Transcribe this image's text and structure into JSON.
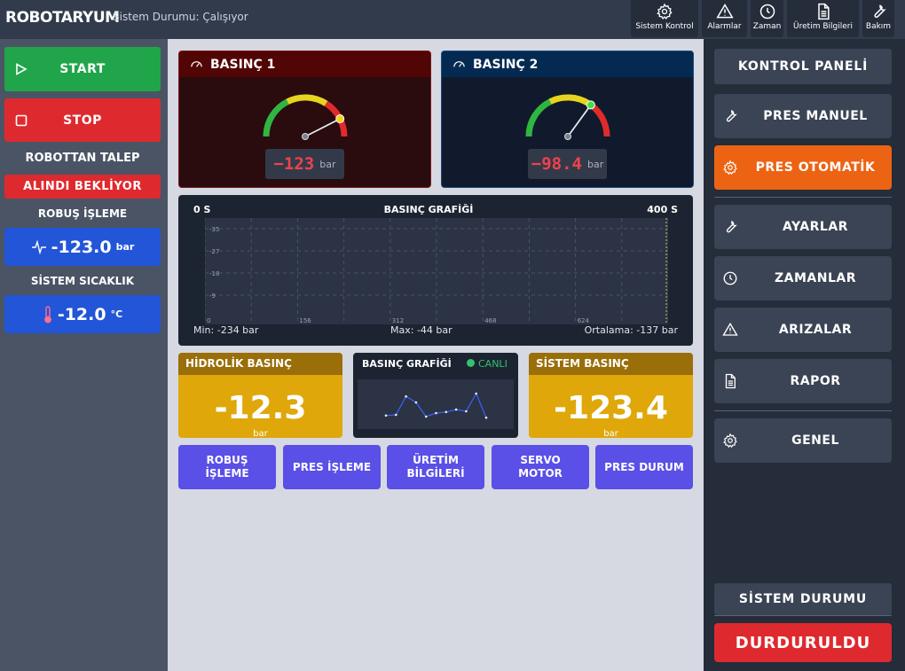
{
  "header": {
    "title": "ROBOTARYUM",
    "status": "Sistem Durumu: Çalışıyor",
    "buttons": [
      {
        "label": "Sistem Kontrol",
        "icon": "gear-icon"
      },
      {
        "label": "Alarmlar",
        "icon": "warning-icon"
      },
      {
        "label": "Zaman",
        "icon": "clock-icon"
      },
      {
        "label": "Üretim Bilgileri",
        "icon": "document-icon"
      },
      {
        "label": "Bakım",
        "icon": "wrench-icon"
      }
    ]
  },
  "left": {
    "start_label": "START",
    "stop_label": "STOP",
    "robot_request_title": "ROBOTTAN TALEP",
    "robot_request_value": "ALINDI BEKLİYOR",
    "robot_work_title": "ROBUŞ İŞLEME",
    "robot_work_value": "-123.0",
    "robot_work_unit": "bar",
    "temp_title": "SİSTEM SICAKLIK",
    "temp_value": "-12.0",
    "temp_unit": "°C"
  },
  "gauge1": {
    "title": "BASINÇ 1",
    "value": "−123",
    "unit": "bar",
    "needle_fraction": 0.85,
    "header_color": "#520505",
    "body_color": "#2a0b0e"
  },
  "gauge2": {
    "title": "BASINÇ 2",
    "value": "−98.4",
    "unit": "bar",
    "needle_fraction": 0.7,
    "header_color": "#052a52",
    "body_color": "#101a2c"
  },
  "chart": {
    "title": "BASINÇ GRAFİĞİ",
    "x_start_label": "0 S",
    "x_end_label": "400 S",
    "min_text": "Min: -234 bar",
    "max_text": "Max: -44 bar",
    "avg_text": "Ortalama: -137 bar"
  },
  "chart_data": {
    "type": "line",
    "title": "BASINÇ GRAFİĞİ",
    "y_ticks": [
      "-35",
      "-27",
      "-18",
      "-9"
    ],
    "x_ticks": [
      "0",
      "156",
      "312",
      "468",
      "624"
    ],
    "ylim": [
      -44,
      0
    ],
    "xlim": [
      0,
      780
    ],
    "series": [],
    "grid": true
  },
  "tiles": {
    "hydraulic": {
      "title": "HİDROLİK BASINÇ",
      "value": "-12.3",
      "unit": "bar"
    },
    "system": {
      "title": "SİSTEM BASINÇ",
      "value": "-123.4",
      "unit": "bar"
    }
  },
  "mini_chart": {
    "title": "BASINÇ GRAFİĞİ",
    "live_label": "CANLI",
    "live_color": "#31c46c",
    "values": [
      0.18,
      0.2,
      0.72,
      0.55,
      0.15,
      0.25,
      0.28,
      0.35,
      0.3,
      0.8,
      0.12
    ]
  },
  "process_buttons": [
    "ROBUŞ İŞLEME",
    "PRES İŞLEME",
    "ÜRETİM BİLGİLERİ",
    "SERVO MOTOR",
    "PRES DURUM"
  ],
  "right": {
    "panel_title": "KONTROL PANELİ",
    "items": [
      {
        "label": "PRES MANUEL",
        "icon": "wrench-icon"
      },
      {
        "label": "PRES OTOMATİK",
        "icon": "gear-icon",
        "active": true
      },
      {
        "label": "AYARLAR",
        "icon": "wrench-icon"
      },
      {
        "label": "ZAMANLAR",
        "icon": "clock-icon"
      },
      {
        "label": "ARIZALAR",
        "icon": "warning-icon"
      },
      {
        "label": "RAPOR",
        "icon": "document-icon"
      },
      {
        "label": "GENEL",
        "icon": "gear-icon"
      }
    ],
    "system_status_title": "SİSTEM DURUMU",
    "system_status_value": "DURDURULDU"
  },
  "colors": {
    "start": "#21a54a",
    "stop": "#de2a2f",
    "active_orange": "#ec6314",
    "blue_value": "#2255d8",
    "purple_button": "#5a4fe6",
    "tile_gold": "#dfa70a"
  }
}
